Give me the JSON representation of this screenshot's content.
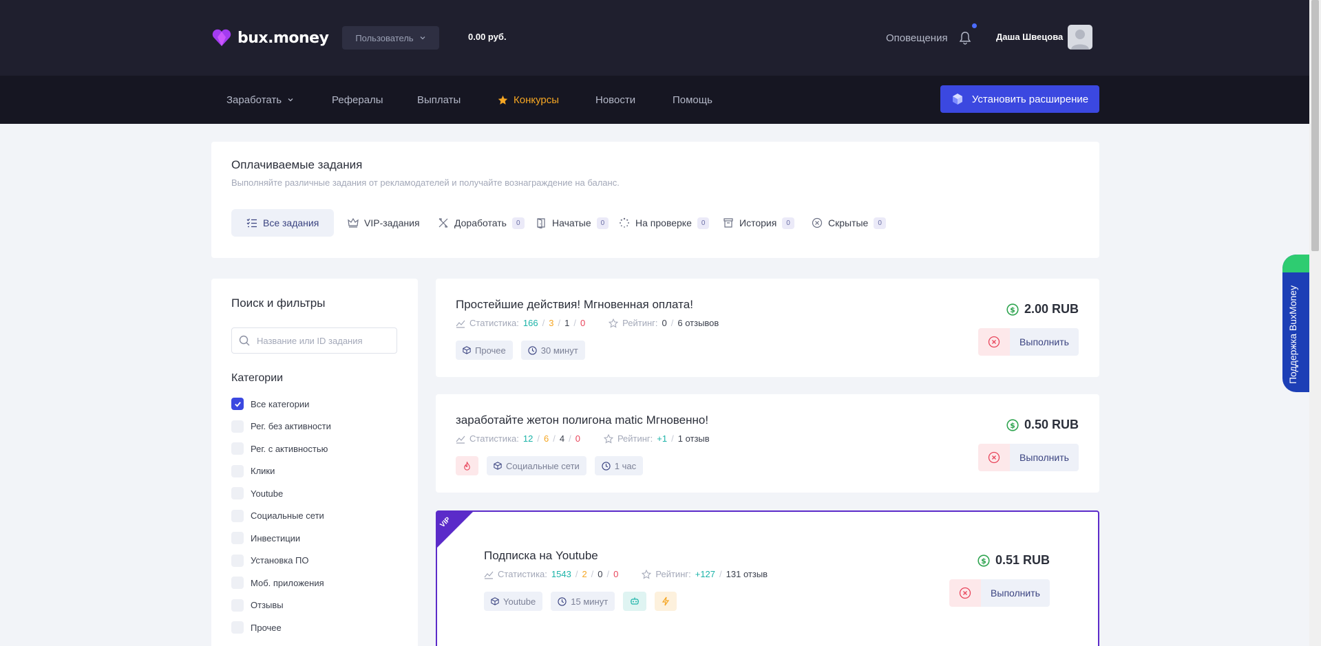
{
  "header": {
    "logo_text": "bux.money",
    "user_select_label": "Пользователь",
    "balance": "0.00 руб.",
    "notifications_label": "Оповещения",
    "user_name": "Даша Швецова"
  },
  "nav": {
    "items": [
      {
        "label": "Заработать"
      },
      {
        "label": "Рефералы"
      },
      {
        "label": "Выплаты"
      },
      {
        "label": "Конкурсы"
      },
      {
        "label": "Новости"
      },
      {
        "label": "Помощь"
      }
    ],
    "install_button": "Установить расширение"
  },
  "tasks_header": {
    "title": "Оплачиваемые задания",
    "subtitle": "Выполняйте различные задания от рекламодателей и получайте вознаграждение на баланс.",
    "tabs": [
      {
        "label": "Все задания",
        "count": null
      },
      {
        "label": "VIP-задания",
        "count": null
      },
      {
        "label": "Доработать",
        "count": "0"
      },
      {
        "label": "Начатые",
        "count": "0"
      },
      {
        "label": "На проверке",
        "count": "0"
      },
      {
        "label": "История",
        "count": "0"
      },
      {
        "label": "Скрытые",
        "count": "0"
      }
    ]
  },
  "filters": {
    "title": "Поиск и фильтры",
    "search_placeholder": "Название или ID задания",
    "categories_title": "Категории",
    "categories": [
      {
        "label": "Все категории",
        "checked": true
      },
      {
        "label": "Рег. без активности",
        "checked": false
      },
      {
        "label": "Рег. с активностью",
        "checked": false
      },
      {
        "label": "Клики",
        "checked": false
      },
      {
        "label": "Youtube",
        "checked": false
      },
      {
        "label": "Социальные сети",
        "checked": false
      },
      {
        "label": "Инвестиции",
        "checked": false
      },
      {
        "label": "Установка ПО",
        "checked": false
      },
      {
        "label": "Моб. приложения",
        "checked": false
      },
      {
        "label": "Отзывы",
        "checked": false
      },
      {
        "label": "Прочее",
        "checked": false
      }
    ]
  },
  "task_labels": {
    "stats": "Статистика:",
    "rating": "Рейтинг:",
    "do_button": "Выполнить",
    "vip": "VIP"
  },
  "tasks": [
    {
      "title": "Простейшие действия! Мгновенная оплата!",
      "stats": [
        "166",
        "3",
        "1",
        "0"
      ],
      "rating": "0",
      "reviews": "6 отзывов",
      "category": "Прочее",
      "time": "30 минут",
      "price": "2.00 RUB"
    },
    {
      "title": "заработайте жетон полигона matic Мгновенно!",
      "stats": [
        "12",
        "6",
        "4",
        "0"
      ],
      "rating": "+1",
      "reviews": "1 отзыв",
      "category": "Социальные сети",
      "time": "1 час",
      "price": "0.50 RUB"
    },
    {
      "title": "Подписка на Youtube",
      "stats": [
        "1543",
        "2",
        "0",
        "0"
      ],
      "rating": "+127",
      "reviews": "131 отзыв",
      "category": "Youtube",
      "time": "15 минут",
      "price": "0.51 RUB",
      "vip": true
    }
  ],
  "support_label": "Поддержка BuxMoney",
  "colors": {
    "accent": "#3b48e0",
    "header_bg": "#1f1f2e",
    "nav_bg": "#161622",
    "vip": "#5b2bc9",
    "contest": "#f5a623",
    "price_icon": "#2ea44f"
  }
}
